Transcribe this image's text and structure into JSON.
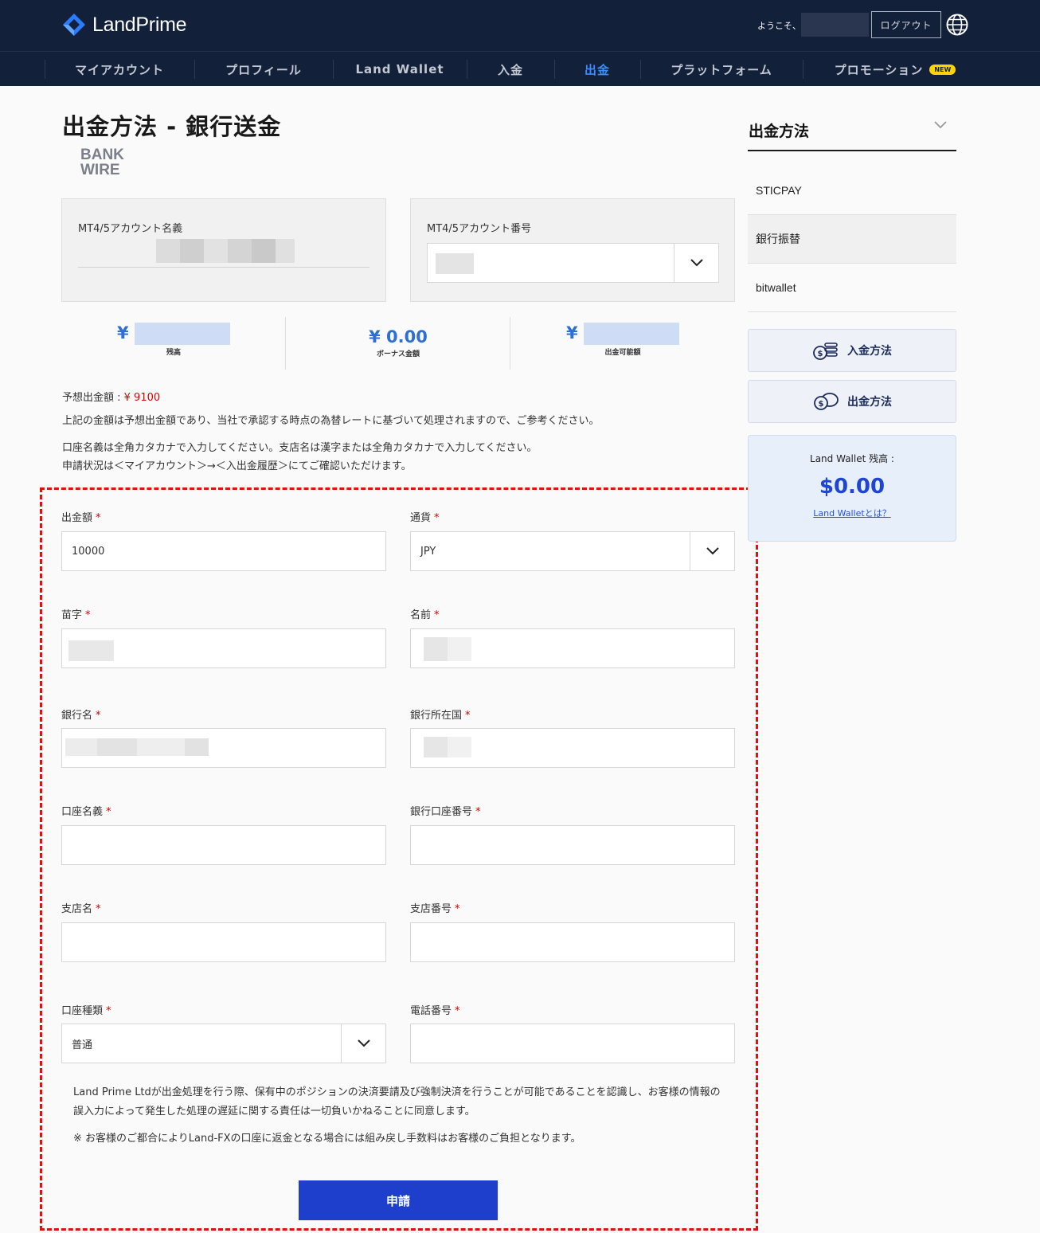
{
  "header": {
    "brand": "LandPrime",
    "welcome": "ようこそ、",
    "logout_label": "ログアウト"
  },
  "nav": {
    "items": [
      {
        "label": "マイアカウント"
      },
      {
        "label": "プロフィール"
      },
      {
        "label": "Land Wallet"
      },
      {
        "label": "入金"
      },
      {
        "label": "出金"
      },
      {
        "label": "プラットフォーム"
      },
      {
        "label": "プロモーション"
      }
    ],
    "active_index": 4,
    "new_badge": "NEW"
  },
  "page": {
    "title": "出金方法 - 銀行送金",
    "logo_line1": "BANK",
    "logo_line2": "WIRE"
  },
  "account": {
    "name_label": "MT4/5アカウント名義",
    "number_label": "MT4/5アカウント番号"
  },
  "balances": {
    "currency_symbol": "¥",
    "balance_label": "残高",
    "bonus_value": "¥ 0.00",
    "bonus_label": "ボーナス金額",
    "withdrawable_label": "出金可能額"
  },
  "info": {
    "expected_label": "予想出金額 : ",
    "expected_value": "¥ 9100",
    "note1": "上記の金額は予想出金額であり、当社で承認する時点の為替レートに基づいて処理されますので、ご参考ください。",
    "note2": "口座名義は全角カタカナで入力してください。支店名は漢字または全角カタカナで入力してください。",
    "note3": "申請状況は＜マイアカウント＞→＜入出金履歴＞にてご確認いただけます。"
  },
  "form": {
    "amount_label": "出金額",
    "amount_value": "10000",
    "currency_label": "通貨",
    "currency_value": "JPY",
    "last_name_label": "苗字",
    "first_name_label": "名前",
    "bank_name_label": "銀行名",
    "bank_country_label": "銀行所在国",
    "account_holder_label": "口座名義",
    "account_number_label": "銀行口座番号",
    "branch_name_label": "支店名",
    "branch_number_label": "支店番号",
    "account_type_label": "口座種類",
    "account_type_value": "普通",
    "phone_label": "電話番号",
    "required_mark": "*",
    "disclaimer1": "Land Prime Ltdが出金処理を行う際、保有中のポジションの決済要請及び強制決済を行うことが可能であることを認識し、お客様の情報の誤入力によって発生した処理の遅延に関する責任は一切負いかねることに同意します。",
    "disclaimer2": "※ お客様のご都合によりLand-FXの口座に返金となる場合には組み戻し手数料はお客様のご負担となります。",
    "submit_label": "申請"
  },
  "sidebar": {
    "title": "出金方法",
    "methods": [
      {
        "label": "STICPAY"
      },
      {
        "label": "銀行振替"
      },
      {
        "label": "bitwallet"
      }
    ],
    "deposit_button": "入金方法",
    "withdraw_button": "出金方法",
    "wallet_label": "Land Wallet 残高 :",
    "wallet_amount": "$0.00",
    "wallet_link": "Land Walletとは？"
  },
  "colors": {
    "header_bg": "#13203a",
    "nav_active": "#3d8bff",
    "accent_blue": "#1e3fcc",
    "required_red": "#d80000",
    "highlight_border": "#e01010"
  }
}
